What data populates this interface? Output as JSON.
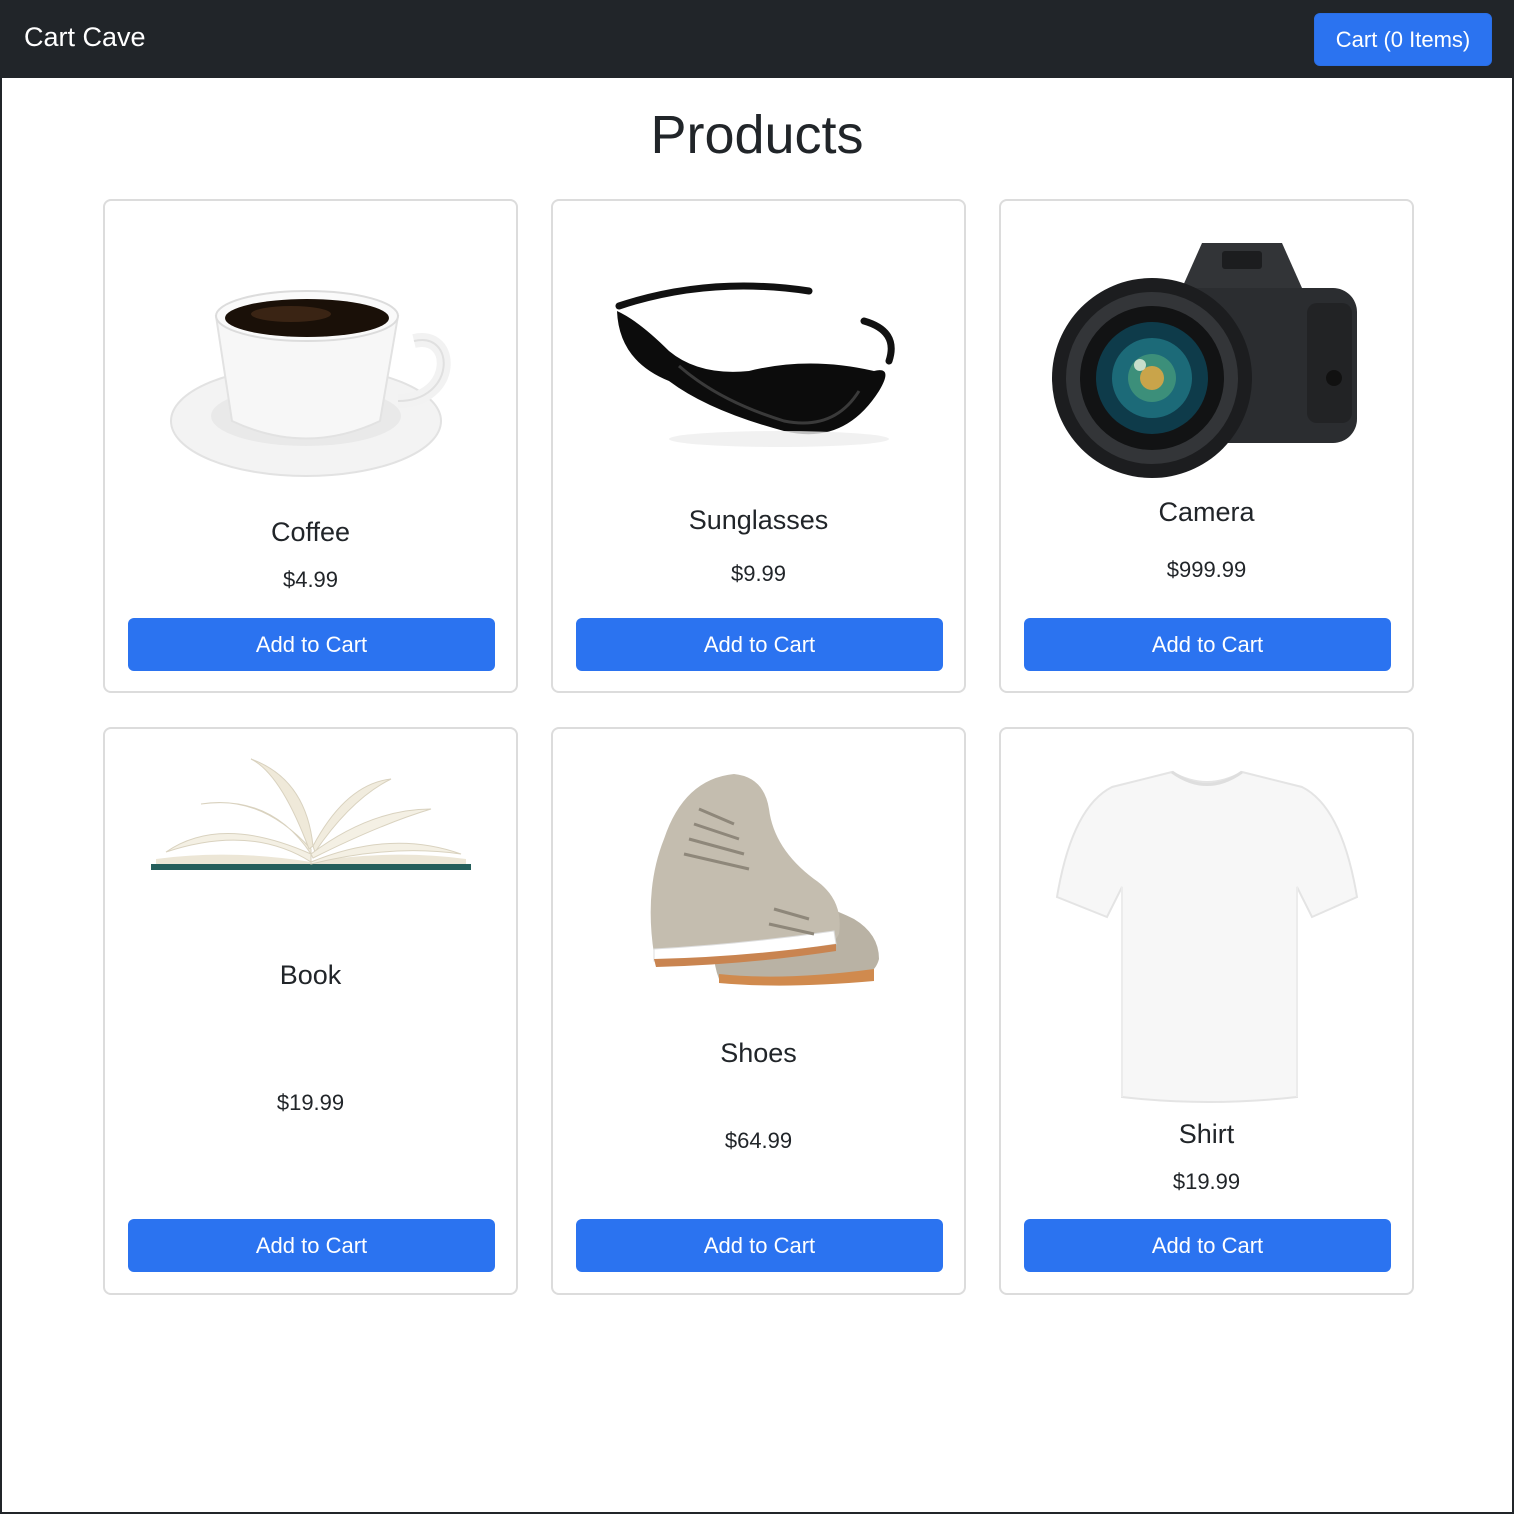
{
  "navbar": {
    "brand": "Cart Cave",
    "cart_button": "Cart (0 Items)"
  },
  "main": {
    "title": "Products"
  },
  "products": [
    {
      "name": "Coffee",
      "price": "$4.99",
      "button": "Add to Cart",
      "icon": "coffee-cup-image"
    },
    {
      "name": "Sunglasses",
      "price": "$9.99",
      "button": "Add to Cart",
      "icon": "sunglasses-image"
    },
    {
      "name": "Camera",
      "price": "$999.99",
      "button": "Add to Cart",
      "icon": "camera-image"
    },
    {
      "name": "Book",
      "price": "$19.99",
      "button": "Add to Cart",
      "icon": "book-image"
    },
    {
      "name": "Shoes",
      "price": "$64.99",
      "button": "Add to Cart",
      "icon": "shoes-image"
    },
    {
      "name": "Shirt",
      "price": "$19.99",
      "button": "Add to Cart",
      "icon": "shirt-image"
    }
  ],
  "colors": {
    "navbar": "#212529",
    "primary": "#2b73f0",
    "card_border": "#dcdcdc"
  }
}
